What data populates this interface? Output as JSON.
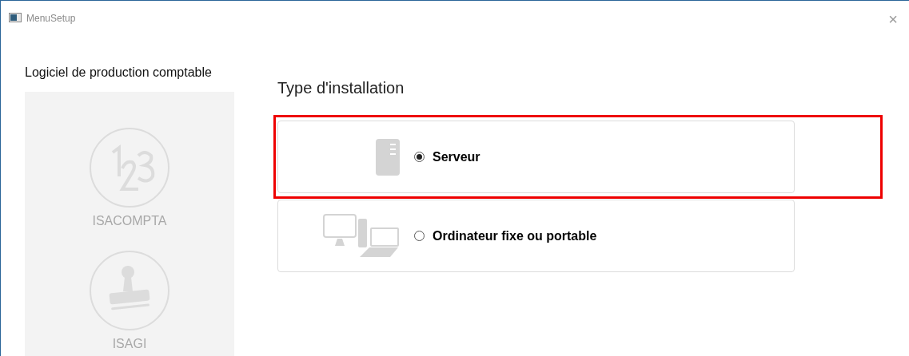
{
  "window": {
    "title": "MenuSetup",
    "close": "×"
  },
  "sidebar": {
    "title": "Logiciel de production comptable",
    "products": [
      {
        "kind": "numbers",
        "label": "ISACOMPTA",
        "disabled": true
      },
      {
        "kind": "stamp",
        "label": "ISAGI",
        "disabled": true
      }
    ]
  },
  "main": {
    "heading": "Type d'installation",
    "options": [
      {
        "kind": "server",
        "label": "Serveur",
        "selected": true,
        "highlighted": true
      },
      {
        "kind": "workstation",
        "label": "Ordinateur fixe ou portable",
        "selected": false,
        "highlighted": false
      }
    ]
  }
}
